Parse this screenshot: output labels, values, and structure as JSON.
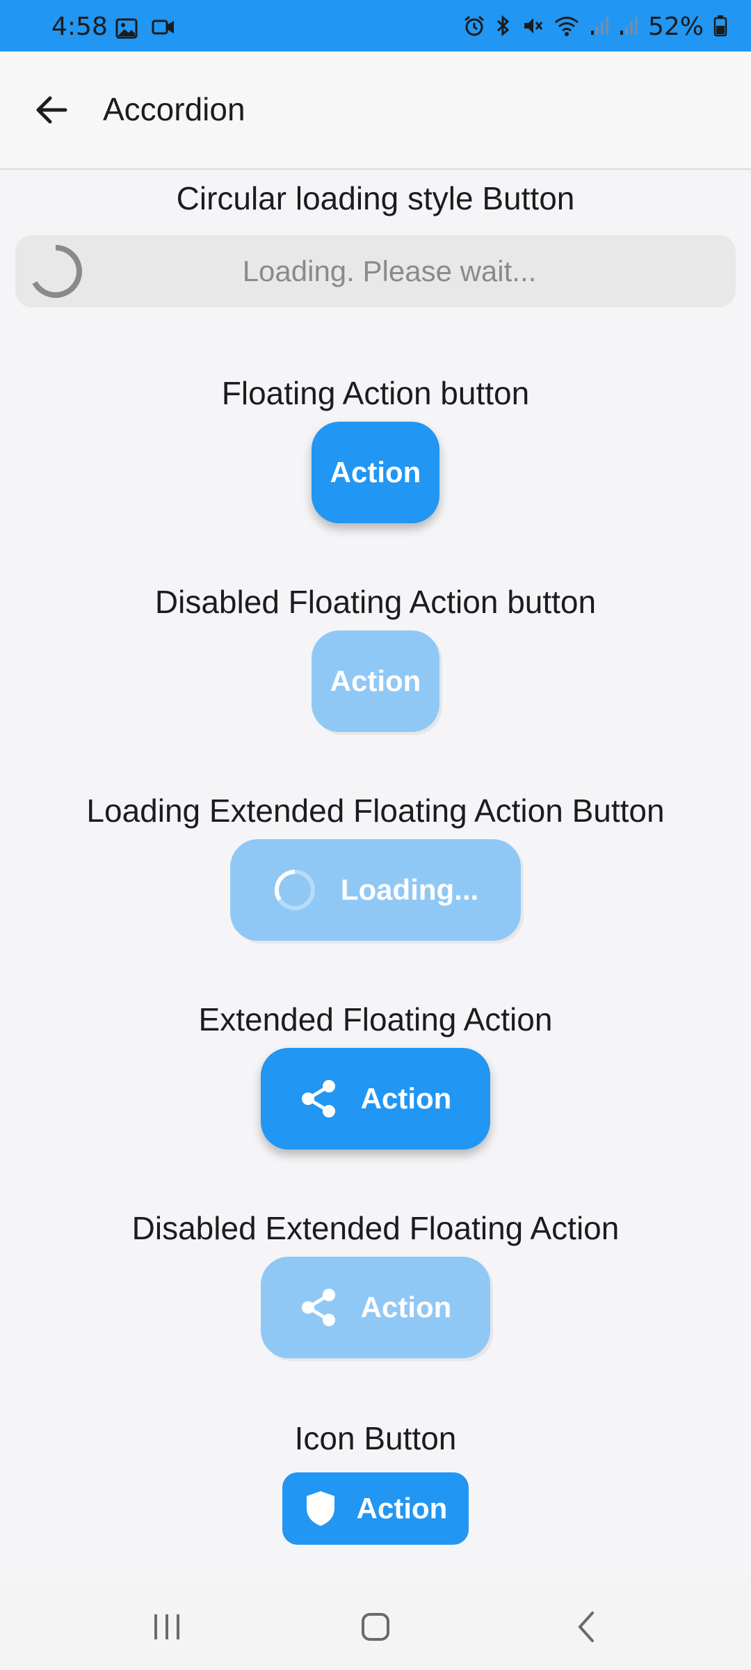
{
  "status_bar": {
    "time": "4:58",
    "battery": "52%",
    "icons_left": [
      "gallery-icon",
      "video-icon"
    ],
    "icons_right": [
      "alarm-icon",
      "bluetooth-icon",
      "mute-icon",
      "wifi-icon",
      "signal-icon",
      "signal-icon",
      "battery-icon"
    ],
    "color": "#2196f3"
  },
  "app_bar": {
    "title": "Accordion"
  },
  "sections": {
    "circular_loading": {
      "title": "Circular loading style Button",
      "button_text": "Loading. Please wait..."
    },
    "fab": {
      "title": "Floating Action button",
      "label": "Action"
    },
    "disabled_fab": {
      "title": "Disabled Floating Action button",
      "label": "Action"
    },
    "loading_extended_fab": {
      "title": "Loading Extended Floating Action Button",
      "label": "Loading..."
    },
    "extended_fab": {
      "title": "Extended Floating Action",
      "label": "Action",
      "icon": "share-icon"
    },
    "disabled_extended_fab": {
      "title": "Disabled Extended Floating Action",
      "label": "Action",
      "icon": "share-icon"
    },
    "icon_button": {
      "title": "Icon Button",
      "label": "Action",
      "icon": "shield-icon"
    }
  },
  "colors": {
    "primary": "#2196f3",
    "primary_disabled": "#90c8f5",
    "background": "#f5f5f7"
  }
}
